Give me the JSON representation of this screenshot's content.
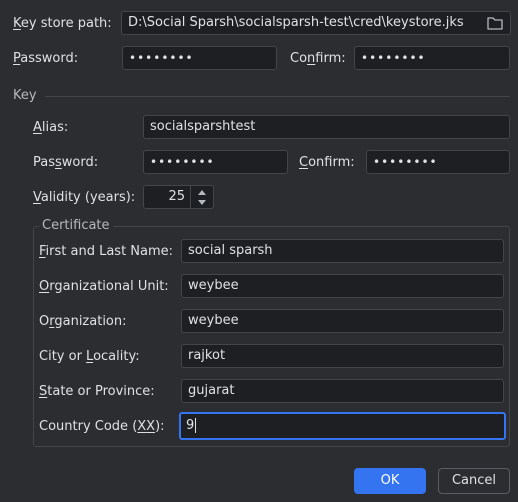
{
  "keystore": {
    "path_label": "Key store path:",
    "path_value": "D:\\Social Sparsh\\socialsparsh-test\\cred\\keystore.jks",
    "password_label": "Password:",
    "password_value": "••••••••",
    "confirm_label": "Confirm:",
    "confirm_value": "••••••••"
  },
  "key": {
    "section_title": "Key",
    "alias_label": "Alias:",
    "alias_value": "socialsparshtest",
    "password_label": "Password:",
    "password_value": "••••••••",
    "confirm_label": "Confirm:",
    "confirm_value": "••••••••",
    "validity_label": "Validity (years):",
    "validity_value": "25"
  },
  "certificate": {
    "section_title": "Certificate",
    "first_last_name_label": "First and Last Name:",
    "first_last_name_value": "social sparsh",
    "org_unit_label": "Organizational Unit:",
    "org_unit_value": "weybee",
    "organization_label": "Organization:",
    "organization_value": "weybee",
    "city_label": "City or Locality:",
    "city_value": "rajkot",
    "state_label": "State or Province:",
    "state_value": "gujarat",
    "country_label": "Country Code (XX):",
    "country_value": "9"
  },
  "buttons": {
    "ok_label": "OK",
    "cancel_label": "Cancel"
  },
  "icons": {
    "browse": "folder-icon",
    "spinner_up": "chevron-up-icon",
    "spinner_down": "chevron-down-icon"
  },
  "colors": {
    "background": "#2b2d30",
    "field_background": "#1e1f22",
    "accent": "#3574f0"
  }
}
